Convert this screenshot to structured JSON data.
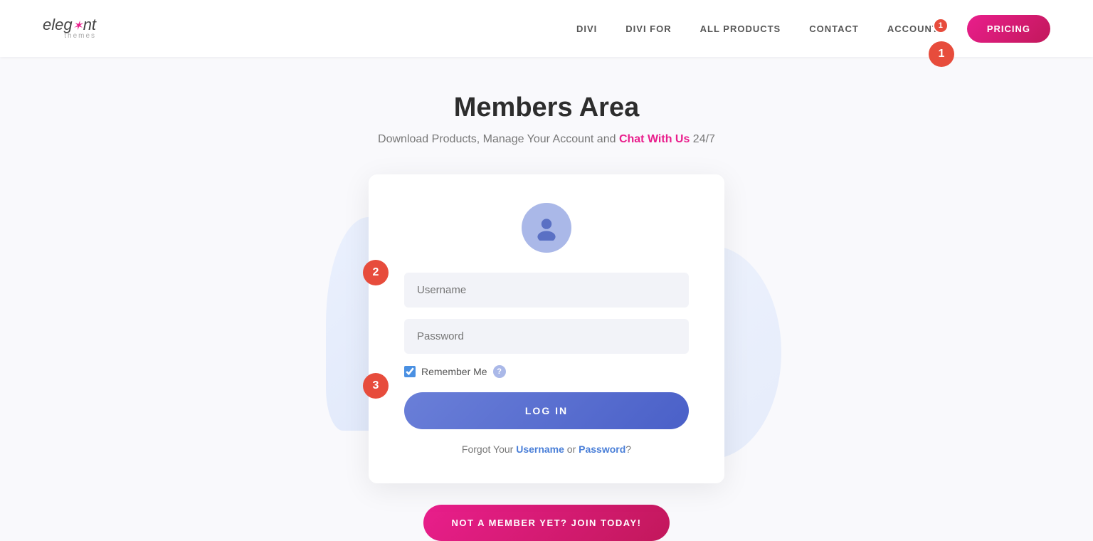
{
  "header": {
    "logo": {
      "brand": "elegant",
      "star": "✦",
      "sub": "themes"
    },
    "nav": {
      "items": [
        {
          "id": "divi",
          "label": "DIVI"
        },
        {
          "id": "divi-for",
          "label": "DIVI FOR"
        },
        {
          "id": "all-products",
          "label": "ALL PRODUCTS"
        },
        {
          "id": "contact",
          "label": "CONTACT"
        },
        {
          "id": "account",
          "label": "ACCOUNT"
        }
      ],
      "account_badge": "1",
      "pricing_label": "PRICING"
    }
  },
  "main": {
    "title": "Members Area",
    "subtitle_pre": "Download Products, Manage Your Account and ",
    "subtitle_link": "Chat With Us",
    "subtitle_post": " 24/7"
  },
  "login_form": {
    "username_placeholder": "Username",
    "password_placeholder": "Password",
    "remember_label": "Remember Me",
    "login_button": "LOG IN",
    "forgot_pre": "Forgot Your ",
    "forgot_username": "Username",
    "forgot_or": " or ",
    "forgot_password": "Password",
    "forgot_post": "?"
  },
  "join_section": {
    "button_label": "NOT A MEMBER YET? JOIN TODAY!"
  },
  "annotations": {
    "badge_1": "1",
    "badge_2": "2",
    "badge_3": "3"
  }
}
